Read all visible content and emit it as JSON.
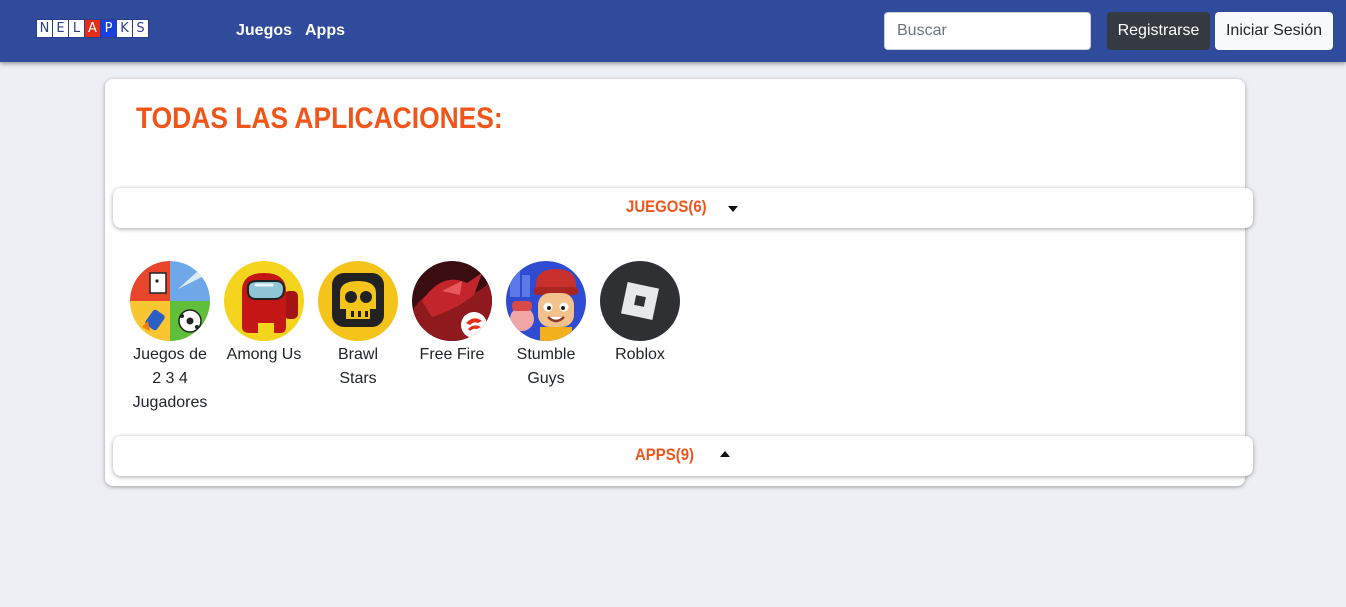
{
  "navbar": {
    "logo_letters": [
      "N",
      "E",
      "L",
      "A",
      "P",
      "K",
      "S"
    ],
    "links": [
      {
        "label": "Juegos"
      },
      {
        "label": "Apps"
      }
    ],
    "search": {
      "placeholder": "Buscar",
      "value": ""
    },
    "register_label": "Registrarse",
    "login_label": "Iniciar Sesión"
  },
  "main": {
    "title": "TODAS LAS APLICACIONES:",
    "sections": [
      {
        "label": "JUEGOS(6)",
        "expanded": true,
        "items": [
          {
            "name": "Juegos de 2 3 4 Jugadores",
            "icon": "multiplayer-games-icon"
          },
          {
            "name": "Among Us",
            "icon": "among-us-icon"
          },
          {
            "name": "Brawl Stars",
            "icon": "brawl-stars-icon"
          },
          {
            "name": "Free Fire",
            "icon": "free-fire-icon"
          },
          {
            "name": "Stumble Guys",
            "icon": "stumble-guys-icon"
          },
          {
            "name": "Roblox",
            "icon": "roblox-icon"
          }
        ]
      },
      {
        "label": "APPS(9)",
        "expanded": false,
        "items": []
      }
    ]
  },
  "colors": {
    "navbar": "#304a9c",
    "accent": "#f2551a",
    "background": "#eceff4"
  }
}
